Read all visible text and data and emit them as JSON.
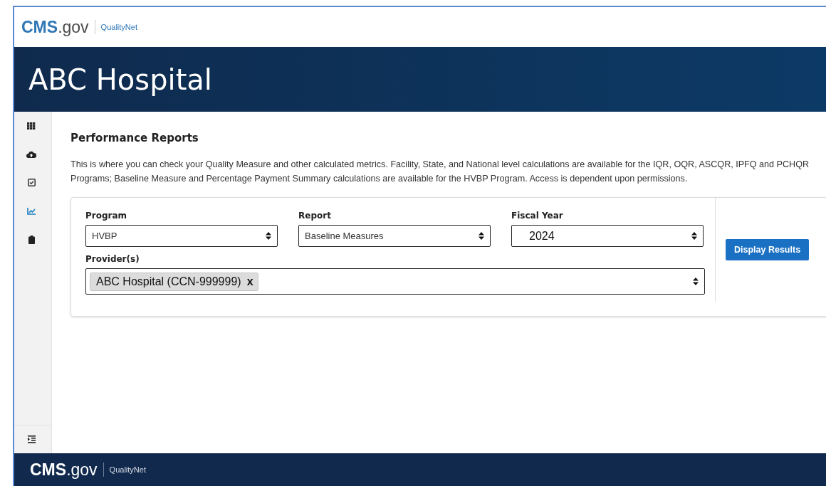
{
  "header": {
    "logo": "**CMS**.gov",
    "subbrand": "QualityNet"
  },
  "banner": {
    "title": "ABC Hospital"
  },
  "sidebar": {
    "items": [
      {
        "kind": "grid",
        "selected": false
      },
      {
        "kind": "cloud",
        "selected": false
      },
      {
        "kind": "checkbox",
        "selected": false
      },
      {
        "kind": "chart",
        "selected": true
      },
      {
        "kind": "clipboard",
        "selected": false
      }
    ]
  },
  "page": {
    "title": "Performance Reports",
    "description": "This is where you can check your Quality Measure and other calculated metrics. Facility, State, and National level calculations are available for the IQR, OQR, ASCQR, IPFQ and PCHQR Programs; Baseline Measure and Percentage Payment Summary calculations are available for the HVBP Program. Access is dependent upon permissions."
  },
  "form": {
    "selects": [
      {
        "label": "Program",
        "value": "HVBP",
        "kind": "small"
      },
      {
        "label": "Report",
        "value": "Baseline Measures",
        "kind": "small"
      },
      {
        "label": "Fiscal Year",
        "value": "2024",
        "kind": "large"
      }
    ],
    "providers": {
      "label": "Provider(s)",
      "tags": [
        "ABC Hospital (CCN-999999)"
      ],
      "remove": "x"
    },
    "button": "Display Results"
  },
  "footer": {
    "logo": "**CMS**.gov",
    "subbrand": "QualityNet"
  }
}
